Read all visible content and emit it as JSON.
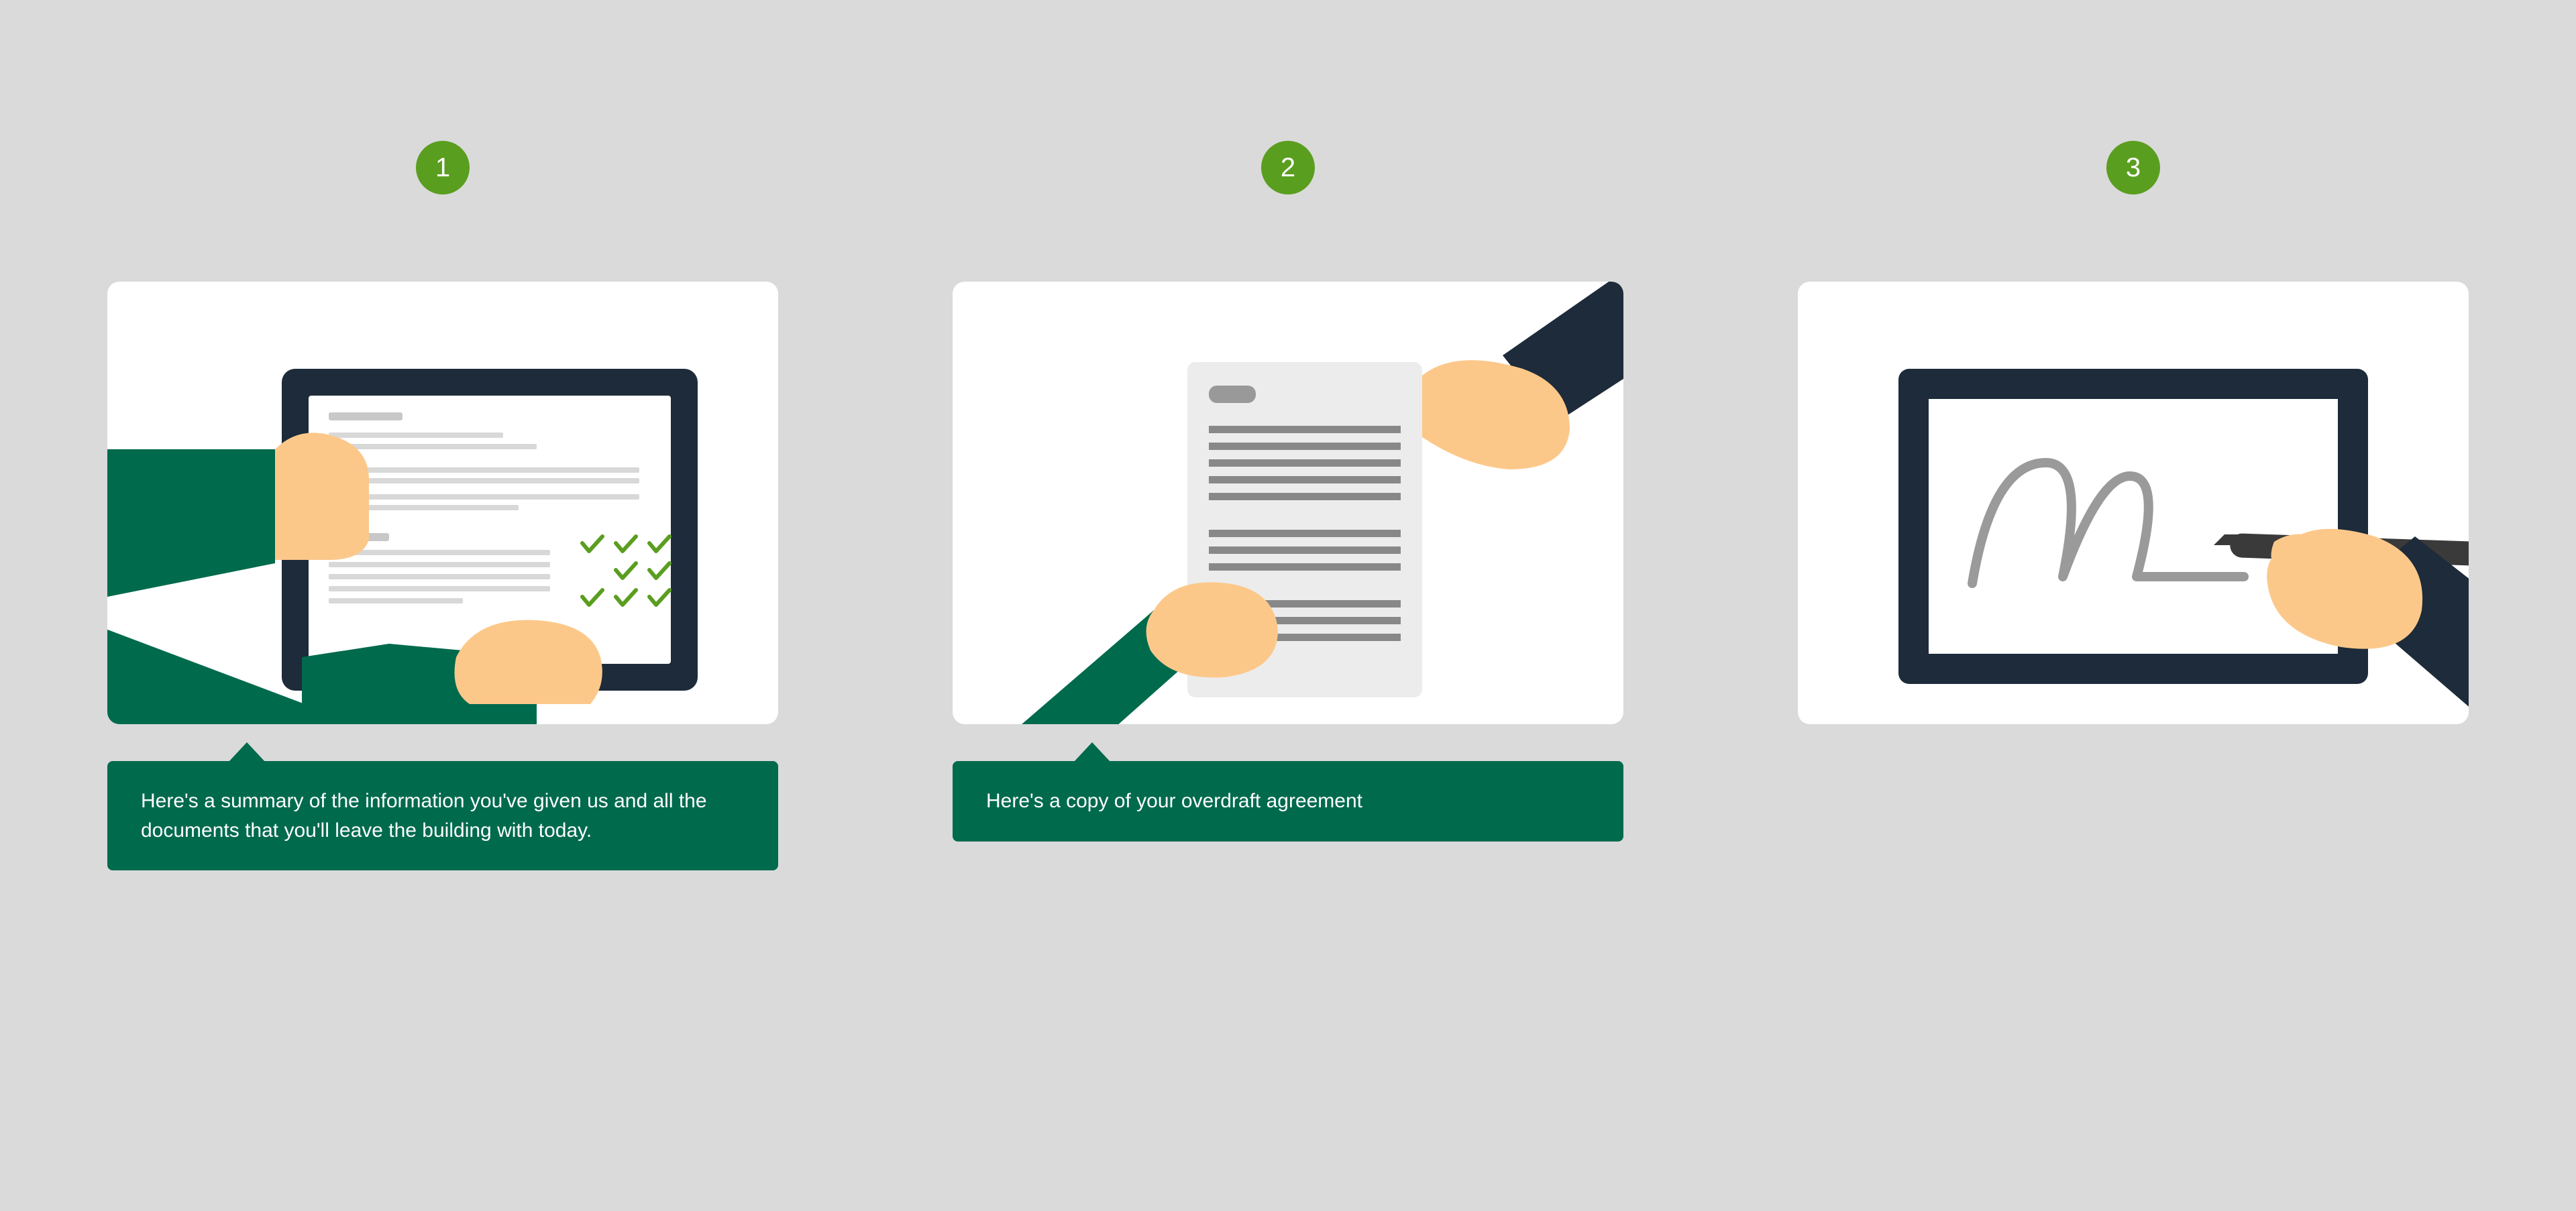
{
  "steps": [
    {
      "number": "1",
      "caption": "Here's a summary of the information you've given us and all the documents that you'll leave the building with today."
    },
    {
      "number": "2",
      "caption": "Here's a copy of your overdraft agreement"
    },
    {
      "number": "3",
      "caption": ""
    }
  ],
  "colors": {
    "badge": "#5a9e1f",
    "speech": "#006a4d",
    "pageBg": "#dadada"
  }
}
